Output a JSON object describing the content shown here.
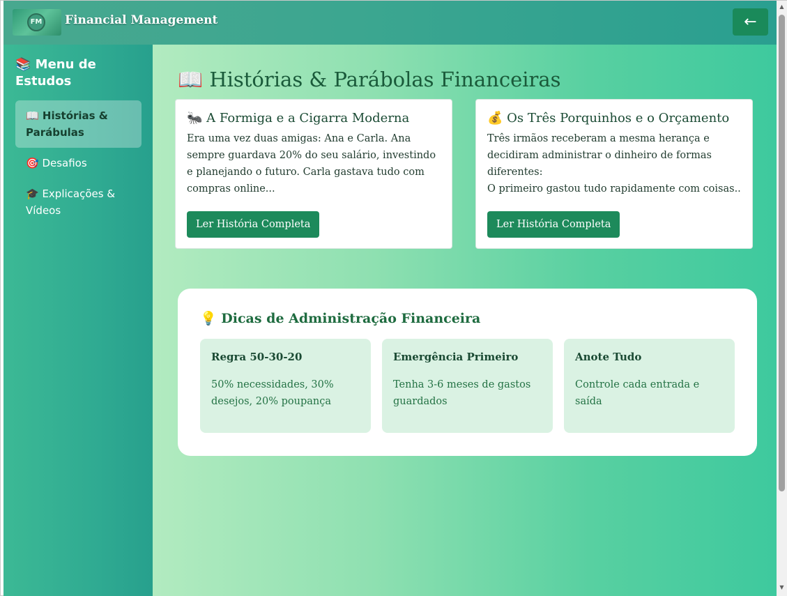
{
  "header": {
    "logo_text": "FM",
    "title": "Financial Management",
    "back_icon": "←"
  },
  "sidebar": {
    "title": "📚 Menu de Estudos",
    "items": [
      {
        "label": "📖 Histórias & Parábulas",
        "active": true
      },
      {
        "label": "🎯 Desafios",
        "active": false
      },
      {
        "label": "🎓 Explicações & Vídeos",
        "active": false
      }
    ]
  },
  "main": {
    "title": "📖 Histórias & Parábolas Financeiras",
    "cards": [
      {
        "title": "🐜 A Formiga e a Cigarra Moderna",
        "text": "Era uma vez duas amigas: Ana e Carla. Ana sempre guardava 20% do seu salário, investindo e planejando o futuro. Carla gastava tudo com compras online...",
        "button": "Ler História Completa"
      },
      {
        "title": "💰 Os Três Porquinhos e o Orçamento",
        "text_lines": [
          "Três irmãos receberam a mesma herança e decidiram administrar o dinheiro de formas diferentes:",
          "O primeiro gastou tudo rapidamente com coisas..."
        ],
        "button": "Ler História Completa"
      }
    ],
    "tips": {
      "title": "💡 Dicas de Administração Financeira",
      "items": [
        {
          "title": "Regra 50-30-20",
          "text": "50% necessidades, 30% desejos, 20% poupança"
        },
        {
          "title": "Emergência Primeiro",
          "text": "Tenha 3-6 meses de gastos guardados"
        },
        {
          "title": "Anote Tudo",
          "text": "Controle cada entrada e saída"
        }
      ]
    }
  },
  "scrollbar": {
    "up_icon": "▲",
    "down_icon": "▼"
  },
  "colors": {
    "header": "#3ca690",
    "button": "#1d8a5b",
    "sidebar": "#30ab92",
    "tip_card": "#daf2e3"
  }
}
